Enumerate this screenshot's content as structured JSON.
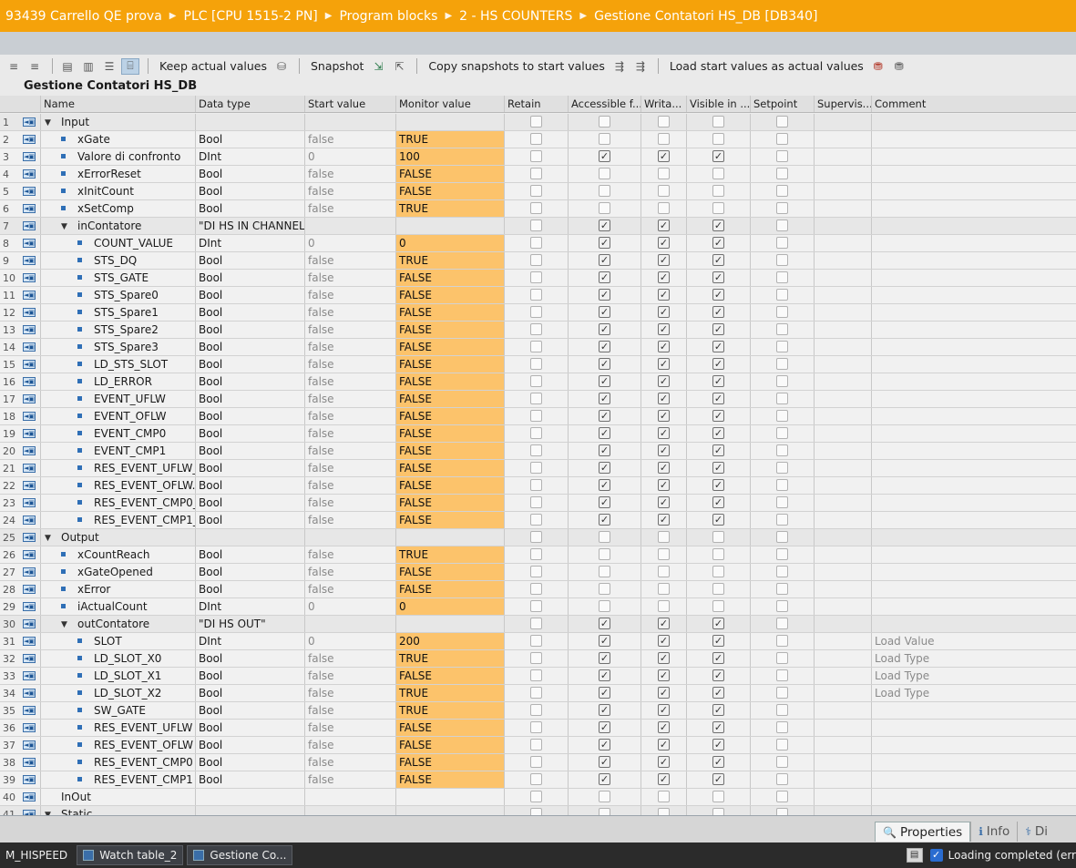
{
  "breadcrumb": [
    "93439 Carrello QE prova",
    "PLC [CPU 1515-2 PN]",
    "Program blocks",
    "2 - HS COUNTERS",
    "Gestione Contatori HS_DB [DB340]"
  ],
  "toolbar": {
    "keep_actual_values": "Keep actual values",
    "snapshot": "Snapshot",
    "copy_snapshots": "Copy snapshots to start values",
    "load_start_values": "Load start values as actual values"
  },
  "block_title": "Gestione Contatori HS_DB",
  "columns": [
    "Name",
    "Data type",
    "Start value",
    "Monitor value",
    "Retain",
    "Accessible f...",
    "Writa...",
    "Visible in ...",
    "Setpoint",
    "Supervis...",
    "Comment"
  ],
  "rows": [
    {
      "n": "1",
      "level": 0,
      "expand": true,
      "name": "Input",
      "type": "",
      "start": "",
      "monitor": "",
      "acc": false,
      "wri": false,
      "vis": false,
      "comment": ""
    },
    {
      "n": "2",
      "level": 1,
      "name": "xGate",
      "type": "Bool",
      "start": "false",
      "monitor": "TRUE",
      "acc": false,
      "wri": false,
      "vis": false,
      "comment": ""
    },
    {
      "n": "3",
      "level": 1,
      "name": "Valore di confronto",
      "type": "DInt",
      "start": "0",
      "monitor": "100",
      "acc": true,
      "wri": true,
      "vis": true,
      "comment": ""
    },
    {
      "n": "4",
      "level": 1,
      "name": "xErrorReset",
      "type": "Bool",
      "start": "false",
      "monitor": "FALSE",
      "acc": false,
      "wri": false,
      "vis": false,
      "comment": ""
    },
    {
      "n": "5",
      "level": 1,
      "name": "xInitCount",
      "type": "Bool",
      "start": "false",
      "monitor": "FALSE",
      "acc": false,
      "wri": false,
      "vis": false,
      "comment": ""
    },
    {
      "n": "6",
      "level": 1,
      "name": "xSetComp",
      "type": "Bool",
      "start": "false",
      "monitor": "TRUE",
      "acc": false,
      "wri": false,
      "vis": false,
      "comment": ""
    },
    {
      "n": "7",
      "level": 1,
      "expand": true,
      "name": "inContatore",
      "type": "\"DI HS IN CHANNEL\"",
      "start": "",
      "monitor": "",
      "acc": true,
      "wri": true,
      "vis": true,
      "comment": ""
    },
    {
      "n": "8",
      "level": 2,
      "name": "COUNT_VALUE",
      "type": "DInt",
      "start": "0",
      "monitor": "0",
      "acc": true,
      "wri": true,
      "vis": true,
      "comment": ""
    },
    {
      "n": "9",
      "level": 2,
      "name": "STS_DQ",
      "type": "Bool",
      "start": "false",
      "monitor": "TRUE",
      "acc": true,
      "wri": true,
      "vis": true,
      "comment": ""
    },
    {
      "n": "10",
      "level": 2,
      "name": "STS_GATE",
      "type": "Bool",
      "start": "false",
      "monitor": "FALSE",
      "acc": true,
      "wri": true,
      "vis": true,
      "comment": ""
    },
    {
      "n": "11",
      "level": 2,
      "name": "STS_Spare0",
      "type": "Bool",
      "start": "false",
      "monitor": "FALSE",
      "acc": true,
      "wri": true,
      "vis": true,
      "comment": ""
    },
    {
      "n": "12",
      "level": 2,
      "name": "STS_Spare1",
      "type": "Bool",
      "start": "false",
      "monitor": "FALSE",
      "acc": true,
      "wri": true,
      "vis": true,
      "comment": ""
    },
    {
      "n": "13",
      "level": 2,
      "name": "STS_Spare2",
      "type": "Bool",
      "start": "false",
      "monitor": "FALSE",
      "acc": true,
      "wri": true,
      "vis": true,
      "comment": ""
    },
    {
      "n": "14",
      "level": 2,
      "name": "STS_Spare3",
      "type": "Bool",
      "start": "false",
      "monitor": "FALSE",
      "acc": true,
      "wri": true,
      "vis": true,
      "comment": ""
    },
    {
      "n": "15",
      "level": 2,
      "name": "LD_STS_SLOT",
      "type": "Bool",
      "start": "false",
      "monitor": "FALSE",
      "acc": true,
      "wri": true,
      "vis": true,
      "comment": ""
    },
    {
      "n": "16",
      "level": 2,
      "name": "LD_ERROR",
      "type": "Bool",
      "start": "false",
      "monitor": "FALSE",
      "acc": true,
      "wri": true,
      "vis": true,
      "comment": ""
    },
    {
      "n": "17",
      "level": 2,
      "name": "EVENT_UFLW",
      "type": "Bool",
      "start": "false",
      "monitor": "FALSE",
      "acc": true,
      "wri": true,
      "vis": true,
      "comment": ""
    },
    {
      "n": "18",
      "level": 2,
      "name": "EVENT_OFLW",
      "type": "Bool",
      "start": "false",
      "monitor": "FALSE",
      "acc": true,
      "wri": true,
      "vis": true,
      "comment": ""
    },
    {
      "n": "19",
      "level": 2,
      "name": "EVENT_CMP0",
      "type": "Bool",
      "start": "false",
      "monitor": "FALSE",
      "acc": true,
      "wri": true,
      "vis": true,
      "comment": ""
    },
    {
      "n": "20",
      "level": 2,
      "name": "EVENT_CMP1",
      "type": "Bool",
      "start": "false",
      "monitor": "FALSE",
      "acc": true,
      "wri": true,
      "vis": true,
      "comment": ""
    },
    {
      "n": "21",
      "level": 2,
      "name": "RES_EVENT_UFLW_",
      "type": "Bool",
      "start": "false",
      "monitor": "FALSE",
      "acc": true,
      "wri": true,
      "vis": true,
      "comment": ""
    },
    {
      "n": "22",
      "level": 2,
      "name": "RES_EVENT_OFLW.",
      "type": "Bool",
      "start": "false",
      "monitor": "FALSE",
      "acc": true,
      "wri": true,
      "vis": true,
      "comment": ""
    },
    {
      "n": "23",
      "level": 2,
      "name": "RES_EVENT_CMP0_",
      "type": "Bool",
      "start": "false",
      "monitor": "FALSE",
      "acc": true,
      "wri": true,
      "vis": true,
      "comment": ""
    },
    {
      "n": "24",
      "level": 2,
      "name": "RES_EVENT_CMP1_",
      "type": "Bool",
      "start": "false",
      "monitor": "FALSE",
      "acc": true,
      "wri": true,
      "vis": true,
      "comment": ""
    },
    {
      "n": "25",
      "level": 0,
      "expand": true,
      "name": "Output",
      "type": "",
      "start": "",
      "monitor": "",
      "acc": false,
      "wri": false,
      "vis": false,
      "comment": ""
    },
    {
      "n": "26",
      "level": 1,
      "name": "xCountReach",
      "type": "Bool",
      "start": "false",
      "monitor": "TRUE",
      "acc": false,
      "wri": false,
      "vis": false,
      "comment": ""
    },
    {
      "n": "27",
      "level": 1,
      "name": "xGateOpened",
      "type": "Bool",
      "start": "false",
      "monitor": "FALSE",
      "acc": false,
      "wri": false,
      "vis": false,
      "comment": ""
    },
    {
      "n": "28",
      "level": 1,
      "name": "xError",
      "type": "Bool",
      "start": "false",
      "monitor": "FALSE",
      "acc": false,
      "wri": false,
      "vis": false,
      "comment": ""
    },
    {
      "n": "29",
      "level": 1,
      "name": "iActualCount",
      "type": "DInt",
      "start": "0",
      "monitor": "0",
      "acc": false,
      "wri": false,
      "vis": false,
      "comment": ""
    },
    {
      "n": "30",
      "level": 1,
      "expand": true,
      "name": "outContatore",
      "type": "\"DI HS OUT\"",
      "start": "",
      "monitor": "",
      "acc": true,
      "wri": true,
      "vis": true,
      "comment": ""
    },
    {
      "n": "31",
      "level": 2,
      "name": "SLOT",
      "type": "DInt",
      "start": "0",
      "monitor": "200",
      "acc": true,
      "wri": true,
      "vis": true,
      "comment": "Load Value"
    },
    {
      "n": "32",
      "level": 2,
      "name": "LD_SLOT_X0",
      "type": "Bool",
      "start": "false",
      "monitor": "TRUE",
      "acc": true,
      "wri": true,
      "vis": true,
      "comment": "Load Type"
    },
    {
      "n": "33",
      "level": 2,
      "name": "LD_SLOT_X1",
      "type": "Bool",
      "start": "false",
      "monitor": "FALSE",
      "acc": true,
      "wri": true,
      "vis": true,
      "comment": "Load Type"
    },
    {
      "n": "34",
      "level": 2,
      "name": "LD_SLOT_X2",
      "type": "Bool",
      "start": "false",
      "monitor": "TRUE",
      "acc": true,
      "wri": true,
      "vis": true,
      "comment": "Load Type"
    },
    {
      "n": "35",
      "level": 2,
      "name": "SW_GATE",
      "type": "Bool",
      "start": "false",
      "monitor": "TRUE",
      "acc": true,
      "wri": true,
      "vis": true,
      "comment": ""
    },
    {
      "n": "36",
      "level": 2,
      "name": "RES_EVENT_UFLW",
      "type": "Bool",
      "start": "false",
      "monitor": "FALSE",
      "acc": true,
      "wri": true,
      "vis": true,
      "comment": ""
    },
    {
      "n": "37",
      "level": 2,
      "name": "RES_EVENT_OFLW",
      "type": "Bool",
      "start": "false",
      "monitor": "FALSE",
      "acc": true,
      "wri": true,
      "vis": true,
      "comment": ""
    },
    {
      "n": "38",
      "level": 2,
      "name": "RES_EVENT_CMP0",
      "type": "Bool",
      "start": "false",
      "monitor": "FALSE",
      "acc": true,
      "wri": true,
      "vis": true,
      "comment": ""
    },
    {
      "n": "39",
      "level": 2,
      "name": "RES_EVENT_CMP1",
      "type": "Bool",
      "start": "false",
      "monitor": "FALSE",
      "acc": true,
      "wri": true,
      "vis": true,
      "comment": ""
    },
    {
      "n": "40",
      "level": 0,
      "name": "InOut",
      "type": "",
      "start": "",
      "monitor": "",
      "acc": false,
      "wri": false,
      "vis": false,
      "comment": ""
    },
    {
      "n": "41",
      "level": 0,
      "expand": true,
      "name": "Static",
      "type": "",
      "start": "",
      "monitor": "",
      "acc": false,
      "wri": false,
      "vis": false,
      "comment": ""
    }
  ],
  "panel_tabs": [
    "Properties",
    "Info",
    "Di"
  ],
  "taskbar": [
    "M_HISPEED",
    "Watch table_2",
    "Gestione Co..."
  ],
  "status": "Loading completed (err",
  "colors": {
    "accent": "#f5a20a",
    "monitor": "#fcc36b",
    "checkbox": "#2a6cd0"
  },
  "icons": [
    "arrow-right-icon",
    "member-icon",
    "snapshot-icon",
    "load-icon",
    "cursor-icon"
  ]
}
